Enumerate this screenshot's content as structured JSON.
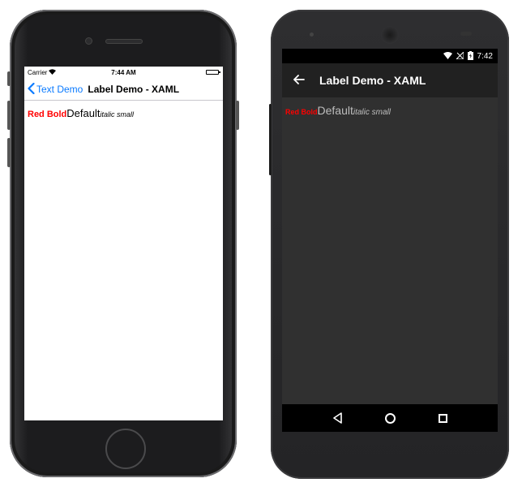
{
  "ios": {
    "status": {
      "carrier": "Carrier",
      "time": "7:44 AM"
    },
    "nav": {
      "back_label": "Text Demo",
      "title": "Label Demo - XAML"
    },
    "labels": {
      "red_bold": "Red Bold",
      "default": "Default",
      "italic_small": "italic small"
    }
  },
  "android": {
    "status": {
      "time": "7:42"
    },
    "toolbar": {
      "title": "Label Demo - XAML"
    },
    "labels": {
      "red_bold": "Red Bold",
      "default": "Default",
      "italic_small": "italic small"
    }
  },
  "colors": {
    "ios_accent": "#0a7aff",
    "label_red": "#ff0000",
    "android_bg": "#303030",
    "android_toolbar": "#212121"
  },
  "icons": {
    "ios_back": "chevron-left-icon",
    "android_back": "arrow-left-icon",
    "android_nav": [
      "triangle-back-icon",
      "circle-home-icon",
      "square-recents-icon"
    ]
  }
}
